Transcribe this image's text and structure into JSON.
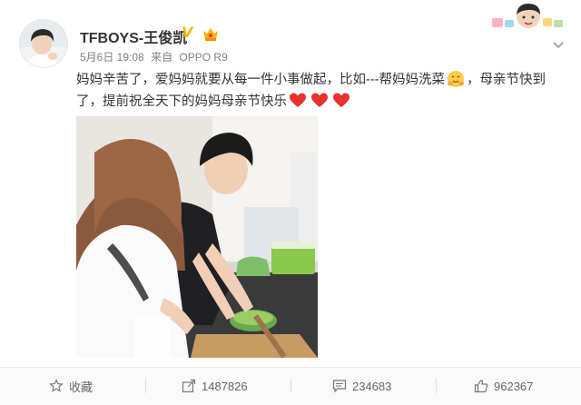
{
  "post": {
    "username": "TFBOYS-王俊凯",
    "verified_icon": "verified-v-icon",
    "date": "5月6日 19:08",
    "source_prefix": "来自",
    "source_device": "OPPO R9",
    "text_part1": "妈妈辛苦了，爱妈妈就要从每一件小事做起，比如---帮妈妈洗菜",
    "text_part2": "，母亲节快到了，提前祝全天下的妈妈母亲节快乐"
  },
  "actions": {
    "favorite_label": "收藏",
    "repost_count": "1487826",
    "comment_count": "234683",
    "like_count": "962367"
  },
  "colors": {
    "accent_orange": "#f7b500",
    "heart_red": "#e8322f",
    "text_main": "#333333",
    "text_muted": "#808080"
  }
}
